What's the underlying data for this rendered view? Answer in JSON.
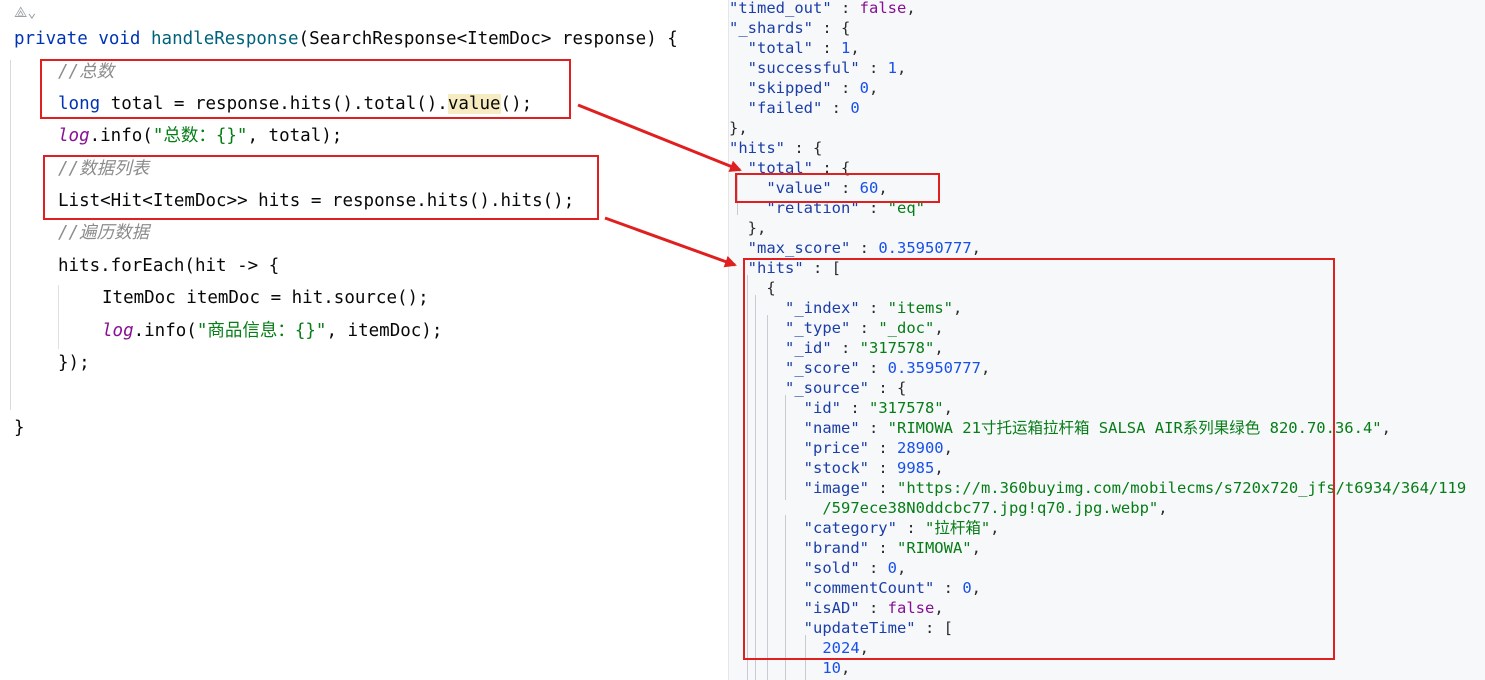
{
  "code": {
    "gutter_icon": "ai-assist-icon",
    "signature": {
      "kw1": "private",
      "kw2": "void",
      "fn": "handleResponse",
      "rest": "(SearchResponse<ItemDoc> response) {"
    },
    "comment_total": "//总数",
    "total_line": {
      "kw": "long",
      "mid": " total = response.hits().total().",
      "hl": "value",
      "end": "();"
    },
    "log_total": {
      "log": "log",
      "a": ".info(",
      "str": "\"总数：{}\"",
      "b": ", total);"
    },
    "comment_list": "//数据列表",
    "hits_line": "List<Hit<ItemDoc>> hits = response.hits().hits();",
    "comment_iter": "//遍历数据",
    "foreach_line": "hits.forEach(hit -> {",
    "itemdoc_line": "ItemDoc itemDoc = hit.source();",
    "log_item": {
      "log": "log",
      "a": ".info(",
      "str": "\"商品信息：{}\"",
      "b": ", itemDoc);"
    },
    "close_lambda": "});",
    "close_method": "}"
  },
  "json": {
    "lines": [
      [
        [
          "k",
          "\"timed_out\""
        ],
        [
          "p",
          " : "
        ],
        [
          "b",
          "false"
        ],
        [
          "p",
          ","
        ]
      ],
      [
        [
          "k",
          "\"_shards\""
        ],
        [
          "p",
          " : {"
        ]
      ],
      [
        [
          "p",
          "  "
        ],
        [
          "k",
          "\"total\""
        ],
        [
          "p",
          " : "
        ],
        [
          "n",
          "1"
        ],
        [
          "p",
          ","
        ]
      ],
      [
        [
          "p",
          "  "
        ],
        [
          "k",
          "\"successful\""
        ],
        [
          "p",
          " : "
        ],
        [
          "n",
          "1"
        ],
        [
          "p",
          ","
        ]
      ],
      [
        [
          "p",
          "  "
        ],
        [
          "k",
          "\"skipped\""
        ],
        [
          "p",
          " : "
        ],
        [
          "n",
          "0"
        ],
        [
          "p",
          ","
        ]
      ],
      [
        [
          "p",
          "  "
        ],
        [
          "k",
          "\"failed\""
        ],
        [
          "p",
          " : "
        ],
        [
          "n",
          "0"
        ]
      ],
      [
        [
          "p",
          "},"
        ]
      ],
      [
        [
          "k",
          "\"hits\""
        ],
        [
          "p",
          " : {"
        ]
      ],
      [
        [
          "p",
          "  "
        ],
        [
          "k",
          "\"total\""
        ],
        [
          "p",
          " : {"
        ]
      ],
      [
        [
          "p",
          "    "
        ],
        [
          "k",
          "\"value\""
        ],
        [
          "p",
          " : "
        ],
        [
          "n",
          "60"
        ],
        [
          "p",
          ","
        ]
      ],
      [
        [
          "p",
          "    "
        ],
        [
          "k",
          "\"relation\""
        ],
        [
          "p",
          " : "
        ],
        [
          "s",
          "\"eq\""
        ]
      ],
      [
        [
          "p",
          "  },"
        ]
      ],
      [
        [
          "p",
          "  "
        ],
        [
          "k",
          "\"max_score\""
        ],
        [
          "p",
          " : "
        ],
        [
          "n",
          "0.35950777"
        ],
        [
          "p",
          ","
        ]
      ],
      [
        [
          "p",
          "  "
        ],
        [
          "k",
          "\"hits\""
        ],
        [
          "p",
          " : ["
        ]
      ],
      [
        [
          "p",
          "    {"
        ]
      ],
      [
        [
          "p",
          "      "
        ],
        [
          "k",
          "\"_index\""
        ],
        [
          "p",
          " : "
        ],
        [
          "s",
          "\"items\""
        ],
        [
          "p",
          ","
        ]
      ],
      [
        [
          "p",
          "      "
        ],
        [
          "k",
          "\"_type\""
        ],
        [
          "p",
          " : "
        ],
        [
          "s",
          "\"_doc\""
        ],
        [
          "p",
          ","
        ]
      ],
      [
        [
          "p",
          "      "
        ],
        [
          "k",
          "\"_id\""
        ],
        [
          "p",
          " : "
        ],
        [
          "s",
          "\"317578\""
        ],
        [
          "p",
          ","
        ]
      ],
      [
        [
          "p",
          "      "
        ],
        [
          "k",
          "\"_score\""
        ],
        [
          "p",
          " : "
        ],
        [
          "n",
          "0.35950777"
        ],
        [
          "p",
          ","
        ]
      ],
      [
        [
          "p",
          "      "
        ],
        [
          "k",
          "\"_source\""
        ],
        [
          "p",
          " : {"
        ]
      ],
      [
        [
          "p",
          "        "
        ],
        [
          "k",
          "\"id\""
        ],
        [
          "p",
          " : "
        ],
        [
          "s",
          "\"317578\""
        ],
        [
          "p",
          ","
        ]
      ],
      [
        [
          "p",
          "        "
        ],
        [
          "k",
          "\"name\""
        ],
        [
          "p",
          " : "
        ],
        [
          "s",
          "\"RIMOWA 21寸托运箱拉杆箱 SALSA AIR系列果绿色 820.70.36.4\""
        ],
        [
          "p",
          ","
        ]
      ],
      [
        [
          "p",
          "        "
        ],
        [
          "k",
          "\"price\""
        ],
        [
          "p",
          " : "
        ],
        [
          "n",
          "28900"
        ],
        [
          "p",
          ","
        ]
      ],
      [
        [
          "p",
          "        "
        ],
        [
          "k",
          "\"stock\""
        ],
        [
          "p",
          " : "
        ],
        [
          "n",
          "9985"
        ],
        [
          "p",
          ","
        ]
      ],
      [
        [
          "p",
          "        "
        ],
        [
          "k",
          "\"image\""
        ],
        [
          "p",
          " : "
        ],
        [
          "s",
          "\"https://m.360buyimg.com/mobilecms/s720x720_jfs/t6934/364/119"
        ]
      ],
      [
        [
          "s",
          "          /597ece38N0ddcbc77.jpg!q70.jpg.webp\""
        ],
        [
          "p",
          ","
        ]
      ],
      [
        [
          "p",
          "        "
        ],
        [
          "k",
          "\"category\""
        ],
        [
          "p",
          " : "
        ],
        [
          "s",
          "\"拉杆箱\""
        ],
        [
          "p",
          ","
        ]
      ],
      [
        [
          "p",
          "        "
        ],
        [
          "k",
          "\"brand\""
        ],
        [
          "p",
          " : "
        ],
        [
          "s",
          "\"RIMOWA\""
        ],
        [
          "p",
          ","
        ]
      ],
      [
        [
          "p",
          "        "
        ],
        [
          "k",
          "\"sold\""
        ],
        [
          "p",
          " : "
        ],
        [
          "n",
          "0"
        ],
        [
          "p",
          ","
        ]
      ],
      [
        [
          "p",
          "        "
        ],
        [
          "k",
          "\"commentCount\""
        ],
        [
          "p",
          " : "
        ],
        [
          "n",
          "0"
        ],
        [
          "p",
          ","
        ]
      ],
      [
        [
          "p",
          "        "
        ],
        [
          "k",
          "\"isAD\""
        ],
        [
          "p",
          " : "
        ],
        [
          "b",
          "false"
        ],
        [
          "p",
          ","
        ]
      ],
      [
        [
          "p",
          "        "
        ],
        [
          "k",
          "\"updateTime\""
        ],
        [
          "p",
          " : ["
        ]
      ],
      [
        [
          "p",
          "          "
        ],
        [
          "n",
          "2024"
        ],
        [
          "p",
          ","
        ]
      ],
      [
        [
          "p",
          "          "
        ],
        [
          "n",
          "10"
        ],
        [
          "p",
          ","
        ]
      ]
    ]
  },
  "colors": {
    "annotation_red": "#e02020",
    "keyword": "#0033b3",
    "comment": "#8c8c8c",
    "string": "#067d17",
    "json_key": "#1b3ea8",
    "json_number": "#1750eb"
  }
}
